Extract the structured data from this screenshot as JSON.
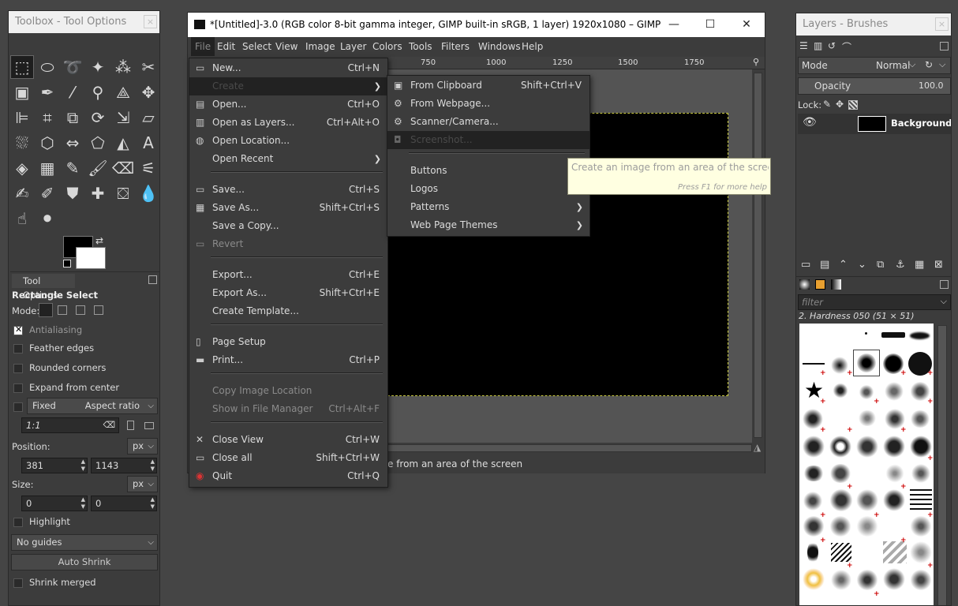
{
  "toolbox": {
    "title": "Toolbox - Tool Options",
    "close": "×",
    "tool_options_tab": "Tool Options",
    "tool_name": "Rectangle Select",
    "mode_label": "Mode:",
    "antialiasing": "Antialiasing",
    "feather_edges": "Feather edges",
    "rounded_corners": "Rounded corners",
    "expand_from_center": "Expand from center",
    "fixed_label": "Fixed",
    "fixed_mode": "Aspect ratio",
    "ratio_value": "1:1",
    "position_label": "Position:",
    "position_unit": "px",
    "pos_x": "381",
    "pos_y": "1143",
    "size_label": "Size:",
    "size_unit": "px",
    "size_w": "0",
    "size_h": "0",
    "highlight": "Highlight",
    "guides": "No guides",
    "auto_shrink": "Auto Shrink",
    "shrink_merged": "Shrink merged"
  },
  "main_window": {
    "title": "*[Untitled]-3.0 (RGB color 8-bit gamma integer, GIMP built-in sRGB, 1 layer) 1920x1080 – GIMP",
    "minimize": "—",
    "maximize": "☐",
    "close": "✕",
    "menubar": [
      "File",
      "Edit",
      "Select",
      "View",
      "Image",
      "Layer",
      "Colors",
      "Tools",
      "Filters",
      "Windows",
      "Help"
    ],
    "ruler_ticks": [
      "750",
      "1000",
      "1250",
      "1500",
      "1750"
    ],
    "status": "e from an area of the screen"
  },
  "file_menu": {
    "items": [
      {
        "label": "New...",
        "accel": "Ctrl+N"
      },
      {
        "label": "Create",
        "accel": ""
      },
      {
        "label": "Open...",
        "accel": "Ctrl+O"
      },
      {
        "label": "Open as Layers...",
        "accel": "Ctrl+Alt+O"
      },
      {
        "label": "Open Location...",
        "accel": ""
      },
      {
        "label": "Open Recent",
        "accel": ""
      },
      {
        "label": "Save...",
        "accel": "Ctrl+S"
      },
      {
        "label": "Save As...",
        "accel": "Shift+Ctrl+S"
      },
      {
        "label": "Save a Copy...",
        "accel": ""
      },
      {
        "label": "Revert",
        "accel": ""
      },
      {
        "label": "Export...",
        "accel": "Ctrl+E"
      },
      {
        "label": "Export As...",
        "accel": "Shift+Ctrl+E"
      },
      {
        "label": "Create Template...",
        "accel": ""
      },
      {
        "label": "Page Setup",
        "accel": ""
      },
      {
        "label": "Print...",
        "accel": "Ctrl+P"
      },
      {
        "label": "Copy Image Location",
        "accel": ""
      },
      {
        "label": "Show in File Manager",
        "accel": "Ctrl+Alt+F"
      },
      {
        "label": "Close View",
        "accel": "Ctrl+W"
      },
      {
        "label": "Close all",
        "accel": "Shift+Ctrl+W"
      },
      {
        "label": "Quit",
        "accel": "Ctrl+Q"
      }
    ]
  },
  "create_menu": {
    "items": [
      {
        "label": "From Clipboard",
        "accel": "Shift+Ctrl+V"
      },
      {
        "label": "From Webpage...",
        "accel": ""
      },
      {
        "label": "Scanner/Camera...",
        "accel": ""
      },
      {
        "label": "Screenshot...",
        "accel": ""
      },
      {
        "label": "Buttons",
        "accel": ""
      },
      {
        "label": "Logos",
        "accel": ""
      },
      {
        "label": "Patterns",
        "accel": ""
      },
      {
        "label": "Web Page Themes",
        "accel": ""
      }
    ]
  },
  "tooltip": {
    "text": "Create an image from an area of the screen",
    "help": "Press F1 for more help"
  },
  "right_dock": {
    "title": "Layers - Brushes",
    "close": "×",
    "mode_label": "Mode",
    "mode_value": "Normal",
    "opacity_label": "Opacity",
    "opacity_value": "100.0",
    "lock_label": "Lock:",
    "layer_name": "Background",
    "filter_placeholder": "filter",
    "brush_name": "2. Hardness 050 (51 × 51)"
  }
}
